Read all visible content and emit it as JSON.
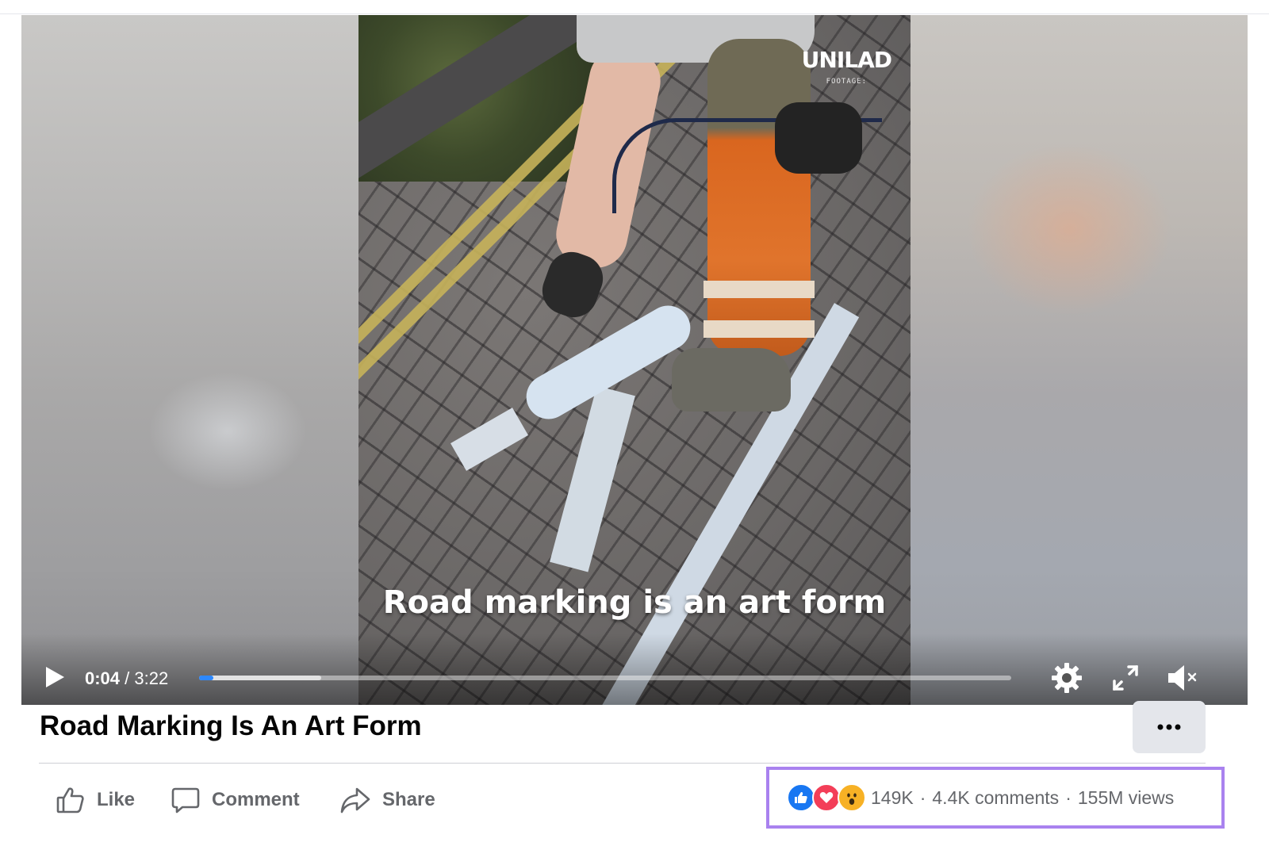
{
  "video": {
    "watermark_brand": "UNILAD",
    "watermark_sub": "FOOTAGE:",
    "caption": "Road marking is an art form",
    "time_current": "0:04",
    "time_separator": "/",
    "time_total": "3:22",
    "progress_played": 0.017,
    "progress_buffered": 0.15,
    "accent_color": "#2d88ff"
  },
  "post": {
    "title": "Road Marking Is An Art Form",
    "more_label": "···"
  },
  "actions": {
    "like": "Like",
    "comment": "Comment",
    "share": "Share"
  },
  "stats": {
    "reactions": [
      "like-icon",
      "love-icon",
      "wow-icon"
    ],
    "reaction_count": "149K",
    "comments": "4.4K comments",
    "views": "155M views",
    "separator": "·",
    "highlight_color": "#a982ef"
  }
}
